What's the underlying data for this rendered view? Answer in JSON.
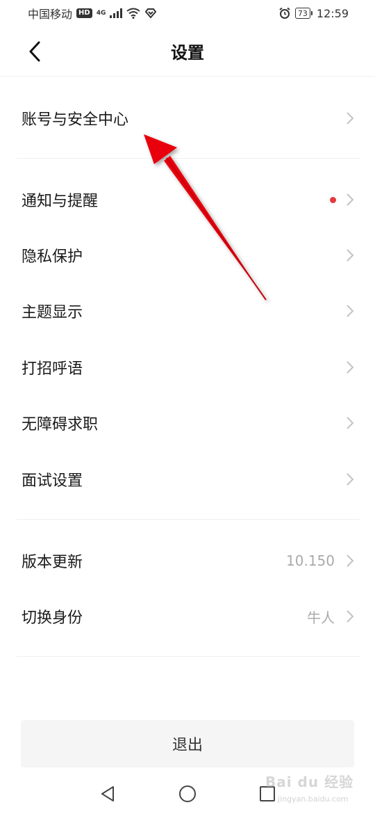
{
  "status_bar": {
    "carrier": "中国移动",
    "hd": "HD",
    "network": "4G",
    "battery": "73",
    "time": "12:59"
  },
  "header": {
    "title": "设置"
  },
  "settings": {
    "account": {
      "label": "账号与安全中心"
    },
    "notify": {
      "label": "通知与提醒"
    },
    "privacy": {
      "label": "隐私保护"
    },
    "theme": {
      "label": "主题显示"
    },
    "greeting": {
      "label": "打招呼语"
    },
    "accessible": {
      "label": "无障碍求职"
    },
    "interview": {
      "label": "面试设置"
    },
    "version": {
      "label": "版本更新",
      "value": "10.150"
    },
    "identity": {
      "label": "切换身份",
      "value": "牛人"
    }
  },
  "logout": {
    "label": "退出"
  },
  "watermark": {
    "brand": "Bai du 经验",
    "url": "jingyan.baidu.com"
  },
  "colors": {
    "accent_red": "#e23b3b",
    "arrow_red": "#e8000a"
  },
  "icons": {
    "back": "back-arrow-icon",
    "chevron": "chevron-right-icon",
    "nav_back": "triangle-back-icon",
    "nav_home": "circle-home-icon",
    "nav_recent": "square-recent-icon"
  }
}
